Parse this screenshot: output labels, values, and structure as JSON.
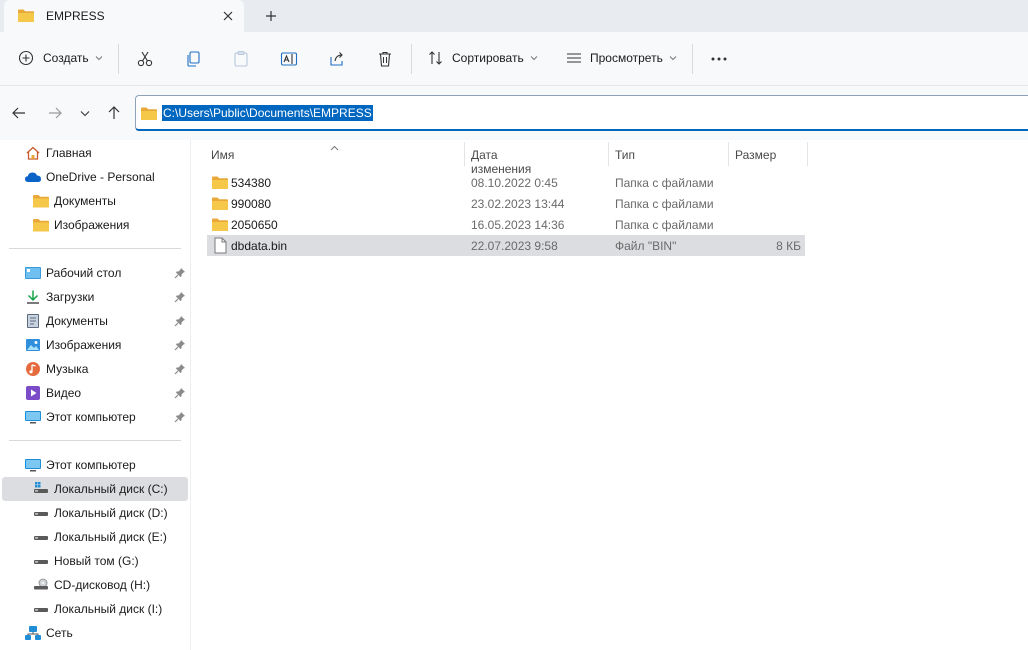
{
  "tab": {
    "title": "EMPRESS",
    "close_icon": "close-icon",
    "new_tab_icon": "plus-icon"
  },
  "toolbar": {
    "create_label": "Создать",
    "sort_label": "Сортировать",
    "view_label": "Просмотреть",
    "icons": [
      "cut-icon",
      "copy-icon",
      "paste-icon",
      "rename-icon",
      "share-icon",
      "delete-icon",
      "more-icon"
    ]
  },
  "address": {
    "path": "C:\\Users\\Public\\Documents\\EMPRESS"
  },
  "sidebar": {
    "top": [
      {
        "label": "Главная",
        "icon": "home-icon"
      },
      {
        "label": "OneDrive - Personal",
        "icon": "cloud-icon"
      },
      {
        "label": "Документы",
        "icon": "folder-icon"
      },
      {
        "label": "Изображения",
        "icon": "folder-icon"
      }
    ],
    "quick": [
      {
        "label": "Рабочий стол",
        "icon": "desktop-icon"
      },
      {
        "label": "Загрузки",
        "icon": "download-icon"
      },
      {
        "label": "Документы",
        "icon": "documents-icon"
      },
      {
        "label": "Изображения",
        "icon": "pictures-icon"
      },
      {
        "label": "Музыка",
        "icon": "music-icon"
      },
      {
        "label": "Видео",
        "icon": "video-icon"
      },
      {
        "label": "Этот компьютер",
        "icon": "computer-icon"
      }
    ],
    "devices": [
      {
        "label": "Этот компьютер",
        "icon": "computer-icon"
      },
      {
        "label": "Локальный диск (C:)",
        "icon": "system-drive-icon",
        "selected": true
      },
      {
        "label": "Локальный диск (D:)",
        "icon": "drive-icon"
      },
      {
        "label": "Локальный диск (E:)",
        "icon": "drive-icon"
      },
      {
        "label": "Новый том (G:)",
        "icon": "drive-icon"
      },
      {
        "label": "CD-дисковод (H:)",
        "icon": "cd-drive-icon"
      },
      {
        "label": "Локальный диск (I:)",
        "icon": "drive-icon"
      },
      {
        "label": "Сеть",
        "icon": "network-icon"
      }
    ]
  },
  "content": {
    "columns": {
      "name": "Имя",
      "date": "Дата изменения",
      "type": "Тип",
      "size": "Размер"
    },
    "rows": [
      {
        "name": "534380",
        "date": "08.10.2022 0:45",
        "type": "Папка с файлами",
        "size": "",
        "kind": "folder"
      },
      {
        "name": "990080",
        "date": "23.02.2023 13:44",
        "type": "Папка с файлами",
        "size": "",
        "kind": "folder"
      },
      {
        "name": "2050650",
        "date": "16.05.2023 14:36",
        "type": "Папка с файлами",
        "size": "",
        "kind": "folder"
      },
      {
        "name": "dbdata.bin",
        "date": "22.07.2023 9:58",
        "type": "Файл \"BIN\"",
        "size": "8 КБ",
        "kind": "file",
        "selected": true
      }
    ]
  },
  "colors": {
    "accent": "#0067c0",
    "folder": "#f5c84a",
    "selection": "#dbdde0"
  }
}
